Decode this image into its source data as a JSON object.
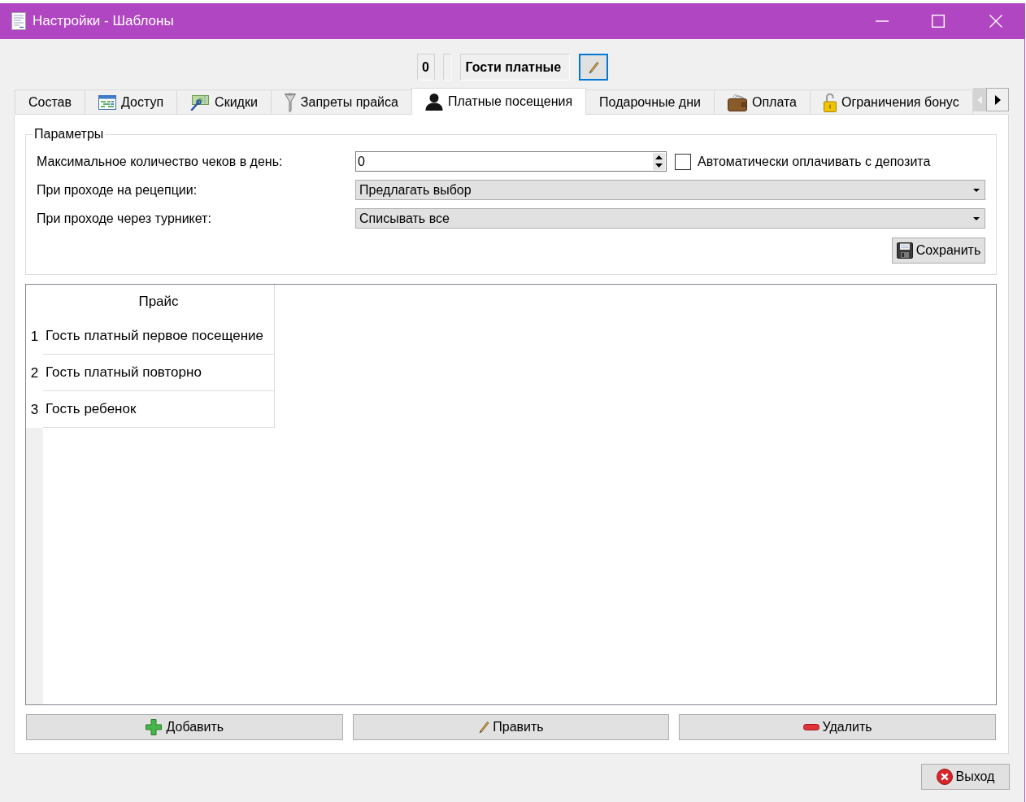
{
  "window": {
    "title": "Настройки - Шаблоны"
  },
  "header": {
    "number": "0",
    "name": "Гости платные",
    "edit_focused": true
  },
  "tabs": [
    {
      "label": "Состав",
      "kind": "plain",
      "selected": false
    },
    {
      "label": "Доступ",
      "kind": "icon",
      "selected": false
    },
    {
      "label": "Скидки",
      "kind": "icon",
      "selected": false
    },
    {
      "label": "Запреты прайса",
      "kind": "icon",
      "selected": false
    },
    {
      "label": "Платные посещения",
      "kind": "icon",
      "selected": true
    },
    {
      "label": "Подарочные дни",
      "kind": "plain",
      "selected": false
    },
    {
      "label": "Оплата",
      "kind": "icon",
      "selected": false
    },
    {
      "label": "Ограничения бонус",
      "kind": "icon",
      "selected": false
    }
  ],
  "tab_scroll": {
    "back_disabled": true,
    "forward_disabled": false
  },
  "parameters": {
    "title": "Параметры",
    "max_checks": {
      "label": "Максимальное количество чеков в день:",
      "value": "0"
    },
    "auto_pay": {
      "label": "Автоматически оплачивать с депозита",
      "checked": false
    },
    "reception": {
      "label": "При проходе на рецепции:",
      "value": "Предлагать выбор"
    },
    "turnstile": {
      "label": "При проходе через турникет:",
      "value": "Списывать все"
    },
    "save_button": "Сохранить"
  },
  "table": {
    "columns": [
      "Прайс"
    ],
    "rows": [
      {
        "number": "1",
        "cells": [
          "Гость платный первое посещение"
        ]
      },
      {
        "number": "2",
        "cells": [
          "Гость платный повторно"
        ]
      },
      {
        "number": "3",
        "cells": [
          "Гость ребенок"
        ]
      }
    ]
  },
  "actions": [
    {
      "label": "Добавить",
      "kind": "add"
    },
    {
      "label": "Править",
      "kind": "edit"
    },
    {
      "label": "Удалить",
      "kind": "delete"
    }
  ],
  "exit_button": "Выход"
}
